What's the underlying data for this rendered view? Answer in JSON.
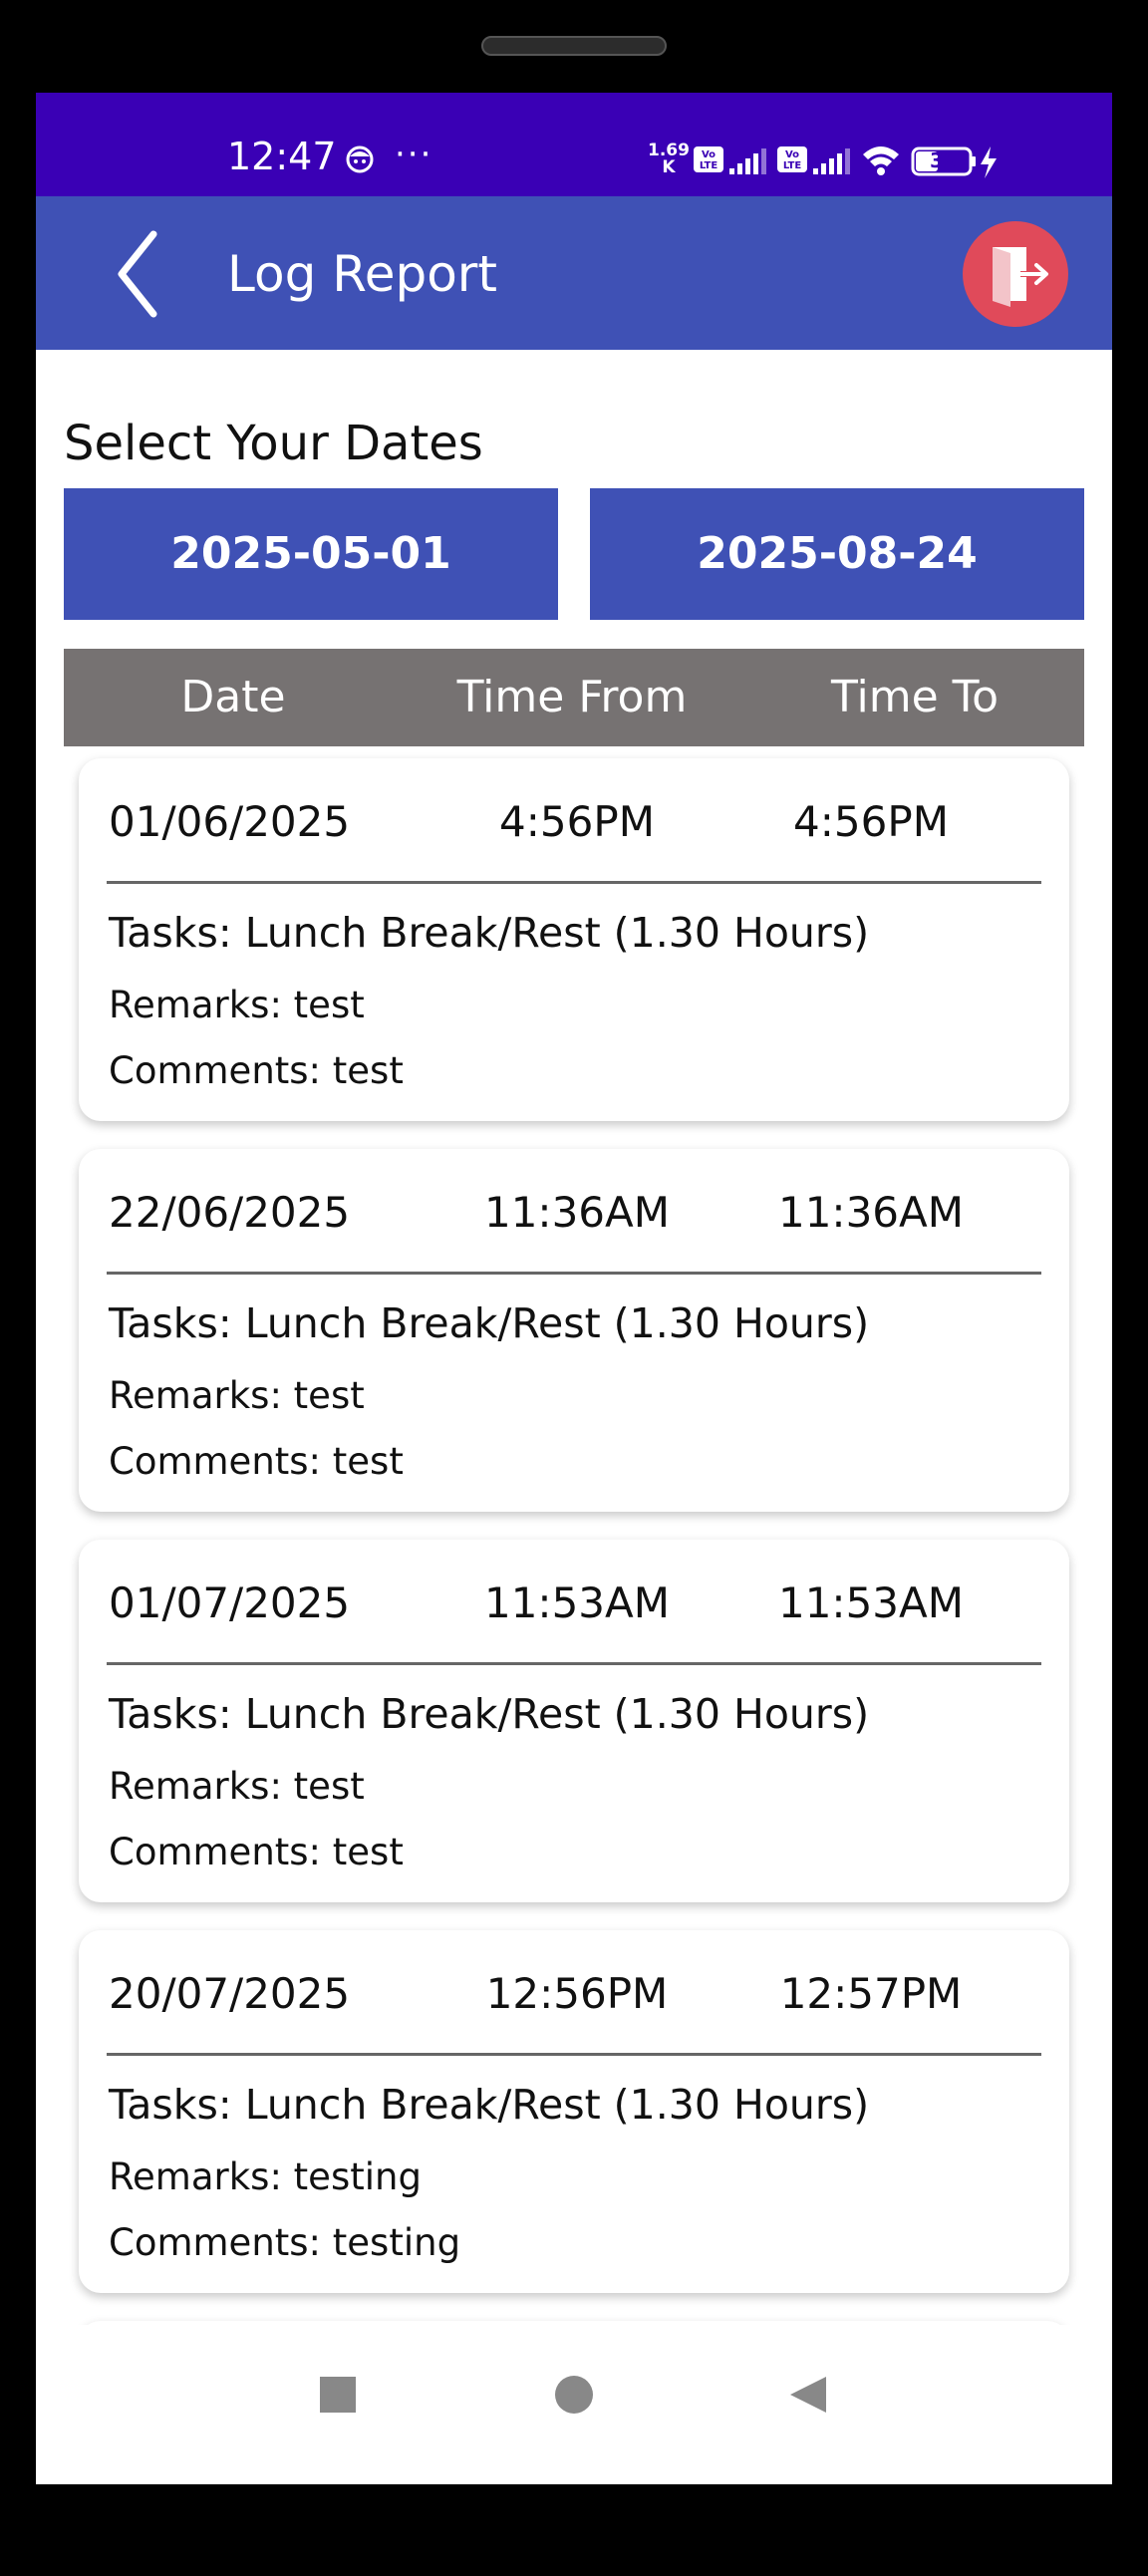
{
  "status_bar": {
    "time": "12:47",
    "more_dots": "···",
    "speed_value": "1.69",
    "speed_unit": "K",
    "battery": "39",
    "sim1_label": "Vo LTE",
    "sim2_label": "Vo LTE"
  },
  "app_bar": {
    "title": "Log Report",
    "back_icon": "chevron-left-icon",
    "logout_icon": "logout-door-icon"
  },
  "date_filter": {
    "label": "Select Your Dates",
    "from_date": "2025-05-01",
    "to_date": "2025-08-24"
  },
  "table": {
    "headers": [
      "Date",
      "Time From",
      "Time To"
    ]
  },
  "entries": [
    {
      "date": "01/06/2025",
      "time_from": "4:56PM",
      "time_to": "4:56PM",
      "tasks": "Tasks: Lunch Break/Rest (1.30 Hours)",
      "remarks": "Remarks: test",
      "comments": "Comments: test"
    },
    {
      "date": "22/06/2025",
      "time_from": "11:36AM",
      "time_to": "11:36AM",
      "tasks": "Tasks: Lunch Break/Rest (1.30 Hours)",
      "remarks": "Remarks: test",
      "comments": "Comments: test"
    },
    {
      "date": "01/07/2025",
      "time_from": "11:53AM",
      "time_to": "11:53AM",
      "tasks": "Tasks: Lunch Break/Rest (1.30 Hours)",
      "remarks": "Remarks: test",
      "comments": "Comments: test"
    },
    {
      "date": "20/07/2025",
      "time_from": "12:56PM",
      "time_to": "12:57PM",
      "tasks": "Tasks: Lunch Break/Rest (1.30 Hours)",
      "remarks": "Remarks: testing",
      "comments": "Comments: testing"
    }
  ],
  "nav_bar": {
    "recents_icon": "square-recents-icon",
    "home_icon": "circle-home-icon",
    "back_icon": "triangle-back-icon"
  },
  "colors": {
    "status_bar": "#3a00b5",
    "app_bar": "#3f51b5",
    "date_button": "#3f51b5",
    "table_header": "#767272",
    "logout_button": "#e04a5a"
  }
}
